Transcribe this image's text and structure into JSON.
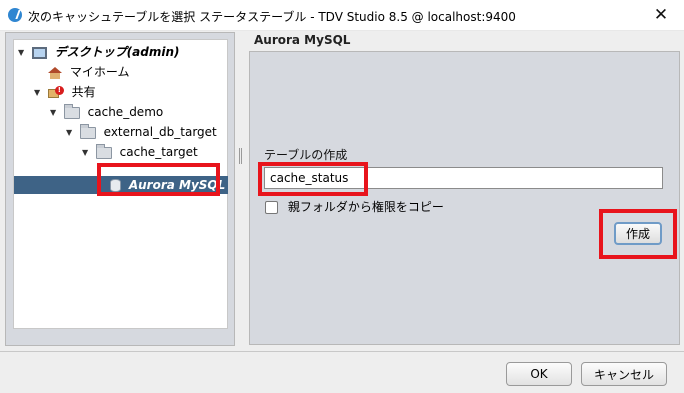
{
  "window": {
    "title": "次のキャッシュテーブルを選択 ステータステーブル - TDV Studio 8.5 @ localhost:9400",
    "close_glyph": "✕"
  },
  "tree": {
    "nodes": [
      {
        "label": "デスクトップ(admin)",
        "icon": "desktop-monitor-icon"
      },
      {
        "label": "マイホーム",
        "icon": "home-icon"
      },
      {
        "label": "共有",
        "icon": "shared-folder-icon"
      },
      {
        "label": "cache_demo",
        "icon": "folder-icon"
      },
      {
        "label": "external_db_target",
        "icon": "folder-icon"
      },
      {
        "label": "cache_target",
        "icon": "folder-icon"
      },
      {
        "label": "Aurora MySQL",
        "icon": "database-icon"
      }
    ],
    "expand_glyph": "▼"
  },
  "right": {
    "header": "Aurora MySQL",
    "table_label": "テーブルの作成",
    "table_value": "cache_status",
    "copy_permissions_label": "親フォルダから権限をコピー",
    "create_label": "作成"
  },
  "footer": {
    "ok_label": "OK",
    "cancel_label": "キャンセル"
  },
  "colors": {
    "highlight": "#e8141c",
    "selection": "#3e6386",
    "panel": "#d6d9df"
  }
}
